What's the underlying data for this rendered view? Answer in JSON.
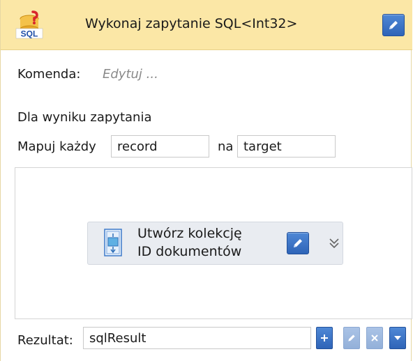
{
  "header": {
    "title": "Wykonaj zapytanie SQL<Int32>",
    "icon_label": "SQL",
    "icon_name": "sql-icon",
    "background": "#fbe7a6"
  },
  "command": {
    "label": "Komenda:",
    "placeholder": "Edytuj ..."
  },
  "mapping": {
    "section_label": "Dla wyniku zapytania",
    "map_each_label": "Mapuj każdy",
    "item_value": "record",
    "na_label": "na",
    "target_value": "target"
  },
  "activity": {
    "title_line1": "Utwórz kolekcję",
    "title_line2": "ID dokumentów",
    "icon_name": "collection-icon"
  },
  "result": {
    "label": "Rezultat:",
    "value": "sqlResult"
  },
  "colors": {
    "accent": "#2e64b8",
    "header": "#fbe7a6",
    "activity_bg": "#e9ecf1"
  }
}
